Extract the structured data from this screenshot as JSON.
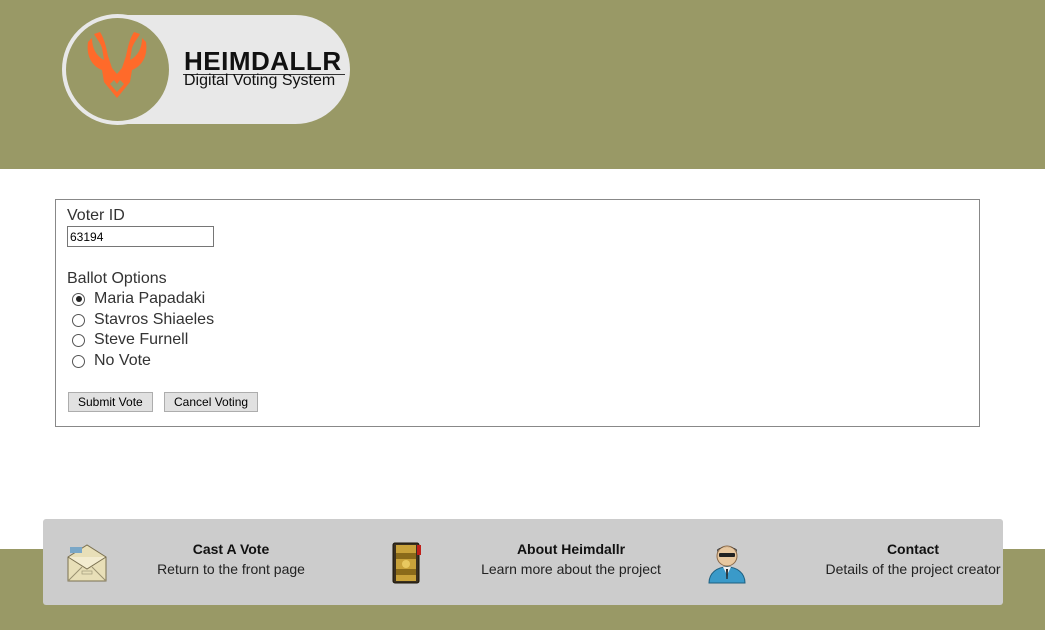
{
  "brand": {
    "title": "HEIMDALLR",
    "subtitle": "Digital Voting System",
    "accent_color": "#ff6a2a",
    "header_color": "#999966"
  },
  "form": {
    "voter_id_label": "Voter ID",
    "voter_id_value": "63194",
    "ballot_label": "Ballot Options",
    "options": [
      {
        "label": "Maria Papadaki",
        "checked": true
      },
      {
        "label": "Stavros Shiaeles",
        "checked": false
      },
      {
        "label": "Steve Furnell",
        "checked": false
      },
      {
        "label": "No Vote",
        "checked": false
      }
    ],
    "submit_label": "Submit Vote",
    "cancel_label": "Cancel Voting"
  },
  "footer": {
    "items": [
      {
        "title": "Cast A Vote",
        "desc": "Return to the front page",
        "icon": "envelope-icon"
      },
      {
        "title": "About Heimdallr",
        "desc": "Learn more about the project",
        "icon": "book-icon"
      },
      {
        "title": "Contact",
        "desc": "Details of the project creator",
        "icon": "user-icon"
      }
    ]
  }
}
